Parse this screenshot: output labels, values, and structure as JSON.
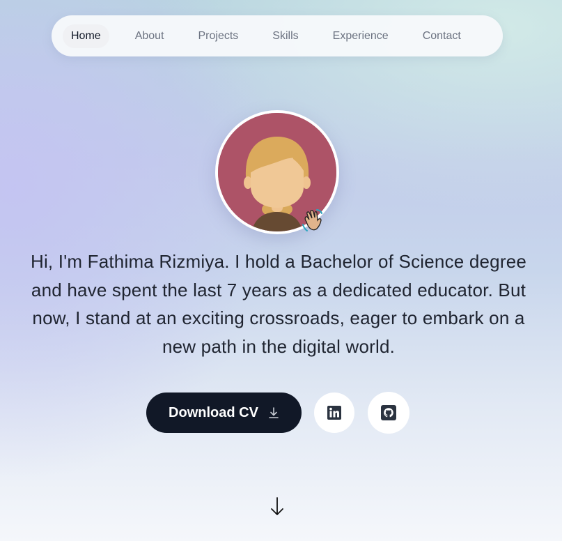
{
  "nav": {
    "items": [
      {
        "label": "Home",
        "active": true
      },
      {
        "label": "About",
        "active": false
      },
      {
        "label": "Projects",
        "active": false
      },
      {
        "label": "Skills",
        "active": false
      },
      {
        "label": "Experience",
        "active": false
      },
      {
        "label": "Contact",
        "active": false
      }
    ]
  },
  "hero": {
    "avatar_icon": "female-avatar-illustration",
    "wave_icon": "waving-hand-emoji",
    "bio": "Hi, I'm Fathima Rizmiya. I hold a Bachelor of Science degree and have spent the last 7 years as a dedicated educator. But now, I stand at an exciting crossroads, eager to embark on a new path in the digital world.",
    "download_label": "Download CV",
    "download_icon": "download-icon",
    "linkedin_icon": "linkedin-icon",
    "github_icon": "github-icon",
    "scroll_icon": "arrow-down-icon"
  },
  "colors": {
    "button_dark": "#111827",
    "avatar_bg": "#ad5367",
    "text": "#1f2430",
    "nav_inactive": "#6b7280"
  }
}
